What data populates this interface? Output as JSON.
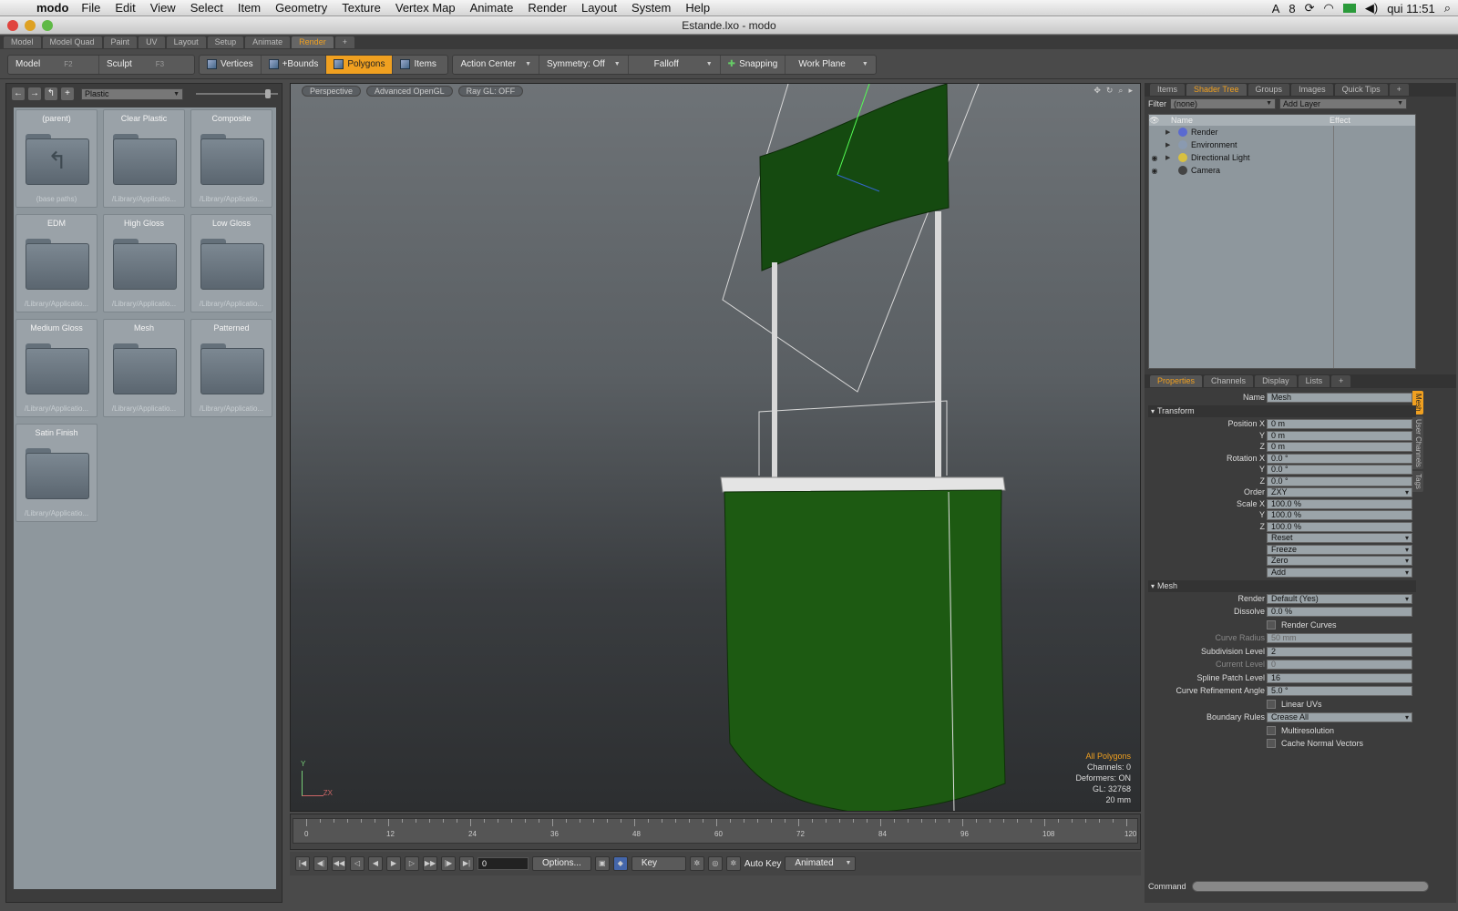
{
  "menubar": {
    "app_name": "modo",
    "items": [
      "File",
      "Edit",
      "View",
      "Select",
      "Item",
      "Geometry",
      "Texture",
      "Vertex Map",
      "Animate",
      "Render",
      "Layout",
      "System",
      "Help"
    ],
    "status": {
      "adobe_count": "8",
      "clock": "qui 11:51"
    }
  },
  "window": {
    "title": "Estande.lxo - modo"
  },
  "layout_tabs": [
    "Model",
    "Model Quad",
    "Paint",
    "UV",
    "Layout",
    "Setup",
    "Animate",
    "Render",
    "+"
  ],
  "active_layout_tab": "Render",
  "toolbar": {
    "model": "Model",
    "model_key": "F2",
    "sculpt": "Sculpt",
    "sculpt_key": "F3",
    "vertices": "Vertices",
    "bounds": "+Bounds",
    "polygons": "Polygons",
    "items": "Items",
    "action_center": "Action Center",
    "symmetry": "Symmetry: Off",
    "falloff": "Falloff",
    "snapping": "Snapping",
    "work_plane": "Work Plane"
  },
  "preset_browser": {
    "path": "Plastic",
    "cells": [
      {
        "name": "(parent)",
        "sub": "(base paths)"
      },
      {
        "name": "Clear Plastic",
        "sub": "/Library/Applicatio..."
      },
      {
        "name": "Composite",
        "sub": "/Library/Applicatio..."
      },
      {
        "name": "EDM",
        "sub": "/Library/Applicatio..."
      },
      {
        "name": "High Gloss",
        "sub": "/Library/Applicatio..."
      },
      {
        "name": "Low Gloss",
        "sub": "/Library/Applicatio..."
      },
      {
        "name": "Medium Gloss",
        "sub": "/Library/Applicatio..."
      },
      {
        "name": "Mesh",
        "sub": "/Library/Applicatio..."
      },
      {
        "name": "Patterned",
        "sub": "/Library/Applicatio..."
      },
      {
        "name": "Satin Finish",
        "sub": "/Library/Applicatio..."
      }
    ]
  },
  "viewport": {
    "view": "Perspective",
    "shading": "Advanced OpenGL",
    "raygl": "Ray GL: OFF",
    "info": {
      "mode": "All Polygons",
      "channels": "Channels: 0",
      "deformers": "Deformers: ON",
      "gl": "GL: 32768",
      "scale": "20 mm"
    },
    "axis_y": "Y",
    "axis_zx": "ZX",
    "colors": {
      "mesh_green": "#1d5a12",
      "banner_green": "#154a10"
    }
  },
  "timeline": {
    "ticks": [
      "0",
      "12",
      "24",
      "36",
      "48",
      "60",
      "72",
      "84",
      "96",
      "108",
      "120"
    ],
    "frame": "0",
    "options": "Options...",
    "key": "Key",
    "auto_key": "Auto Key",
    "animated": "Animated"
  },
  "right_tabs": [
    "Items",
    "Shader Tree",
    "Groups",
    "Images",
    "Quick Tips",
    "+"
  ],
  "active_right_tab": "Shader Tree",
  "shader_tree": {
    "filter_label": "Filter",
    "filter_value": "(none)",
    "add_layer": "Add Layer",
    "col_name": "Name",
    "col_effect": "Effect",
    "rows": [
      {
        "name": "Render",
        "color": "#5a6ad0"
      },
      {
        "name": "Environment",
        "color": "#8a9ab0"
      },
      {
        "name": "Directional Light",
        "color": "#d8c040"
      },
      {
        "name": "Camera",
        "color": "#444444"
      }
    ]
  },
  "prop_tabs": [
    "Properties",
    "Channels",
    "Display",
    "Lists",
    "+"
  ],
  "active_prop_tab": "Properties",
  "side_tabs": [
    "Mesh",
    "User Channels",
    "Tags"
  ],
  "properties": {
    "name_label": "Name",
    "name_value": "Mesh",
    "transform_section": "Transform",
    "position_x_label": "Position X",
    "position_x": "0 m",
    "position_y": "0 m",
    "position_z": "0 m",
    "rotation_x_label": "Rotation X",
    "rotation_x": "0.0 °",
    "rotation_y": "0.0 °",
    "rotation_z": "0.0 °",
    "order_label": "Order",
    "order": "ZXY",
    "scale_x_label": "Scale X",
    "scale_x": "100.0 %",
    "scale_y": "100.0 %",
    "scale_z": "100.0 %",
    "y_label": "Y",
    "z_label": "Z",
    "reset": "Reset",
    "freeze": "Freeze",
    "zero": "Zero",
    "add": "Add",
    "mesh_section": "Mesh",
    "render_label": "Render",
    "render": "Default (Yes)",
    "dissolve_label": "Dissolve",
    "dissolve": "0.0 %",
    "render_curves": "Render Curves",
    "curve_radius_label": "Curve Radius",
    "curve_radius": "50 mm",
    "subdiv_label": "Subdivision Level",
    "subdiv": "2",
    "current_level_label": "Current Level",
    "current_level": "0",
    "spline_label": "Spline Patch Level",
    "spline": "16",
    "refine_label": "Curve Refinement Angle",
    "refine": "5.0 °",
    "linear_uvs": "Linear UVs",
    "boundary_label": "Boundary Rules",
    "boundary": "Crease All",
    "multires": "Multiresolution",
    "cache_normals": "Cache Normal Vectors"
  },
  "command": {
    "label": "Command"
  }
}
